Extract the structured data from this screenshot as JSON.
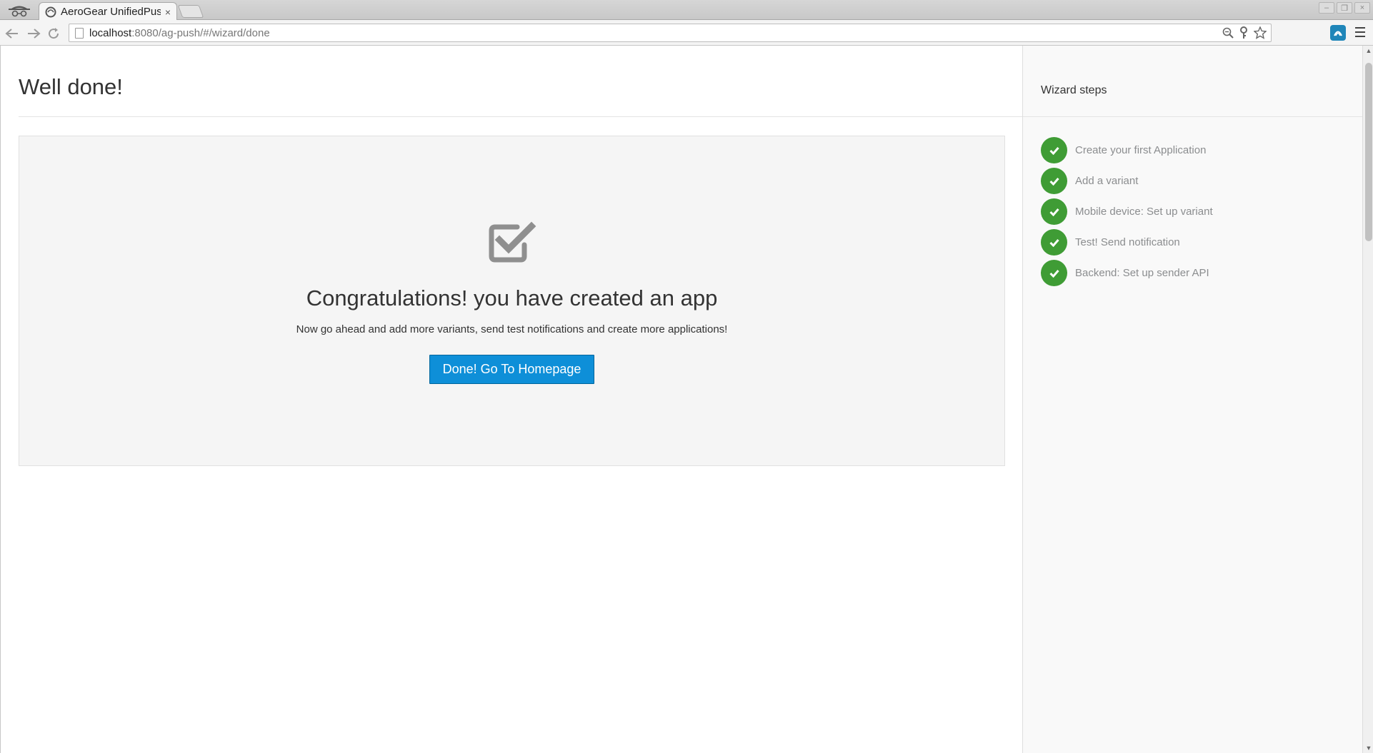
{
  "browser": {
    "tab_title": "AeroGear UnifiedPus",
    "tab_close": "×",
    "url_host": "localhost",
    "url_rest": ":8080/ag-push/#/wizard/done",
    "window_controls": [
      "–",
      "❐",
      "×"
    ],
    "icons": {
      "back": "back-arrow-icon",
      "forward": "forward-arrow-icon",
      "reload": "reload-icon",
      "zoom": "magnifier-icon",
      "key": "key-icon",
      "bookmark": "star-icon",
      "extension": "aerogear-extension-icon",
      "menu": "hamburger-menu-icon"
    }
  },
  "page": {
    "title": "Well done!",
    "congrats_heading": "Congratulations! you have created an app",
    "congrats_text": "Now go ahead and add more variants, send test notifications and create more applications!",
    "done_button": "Done! Go To Homepage"
  },
  "sidebar": {
    "title": "Wizard steps",
    "steps": [
      {
        "label": "Create your first Application",
        "done": true
      },
      {
        "label": "Add a variant",
        "done": true
      },
      {
        "label": "Mobile device: Set up variant",
        "done": true
      },
      {
        "label": "Test! Send notification",
        "done": true
      },
      {
        "label": "Backend: Set up sender API",
        "done": true
      }
    ]
  },
  "colors": {
    "primary_button": "#0e8fd8",
    "step_done": "#3f9c35",
    "well_background": "#f5f5f5",
    "sidebar_background": "#f9f9f9"
  }
}
